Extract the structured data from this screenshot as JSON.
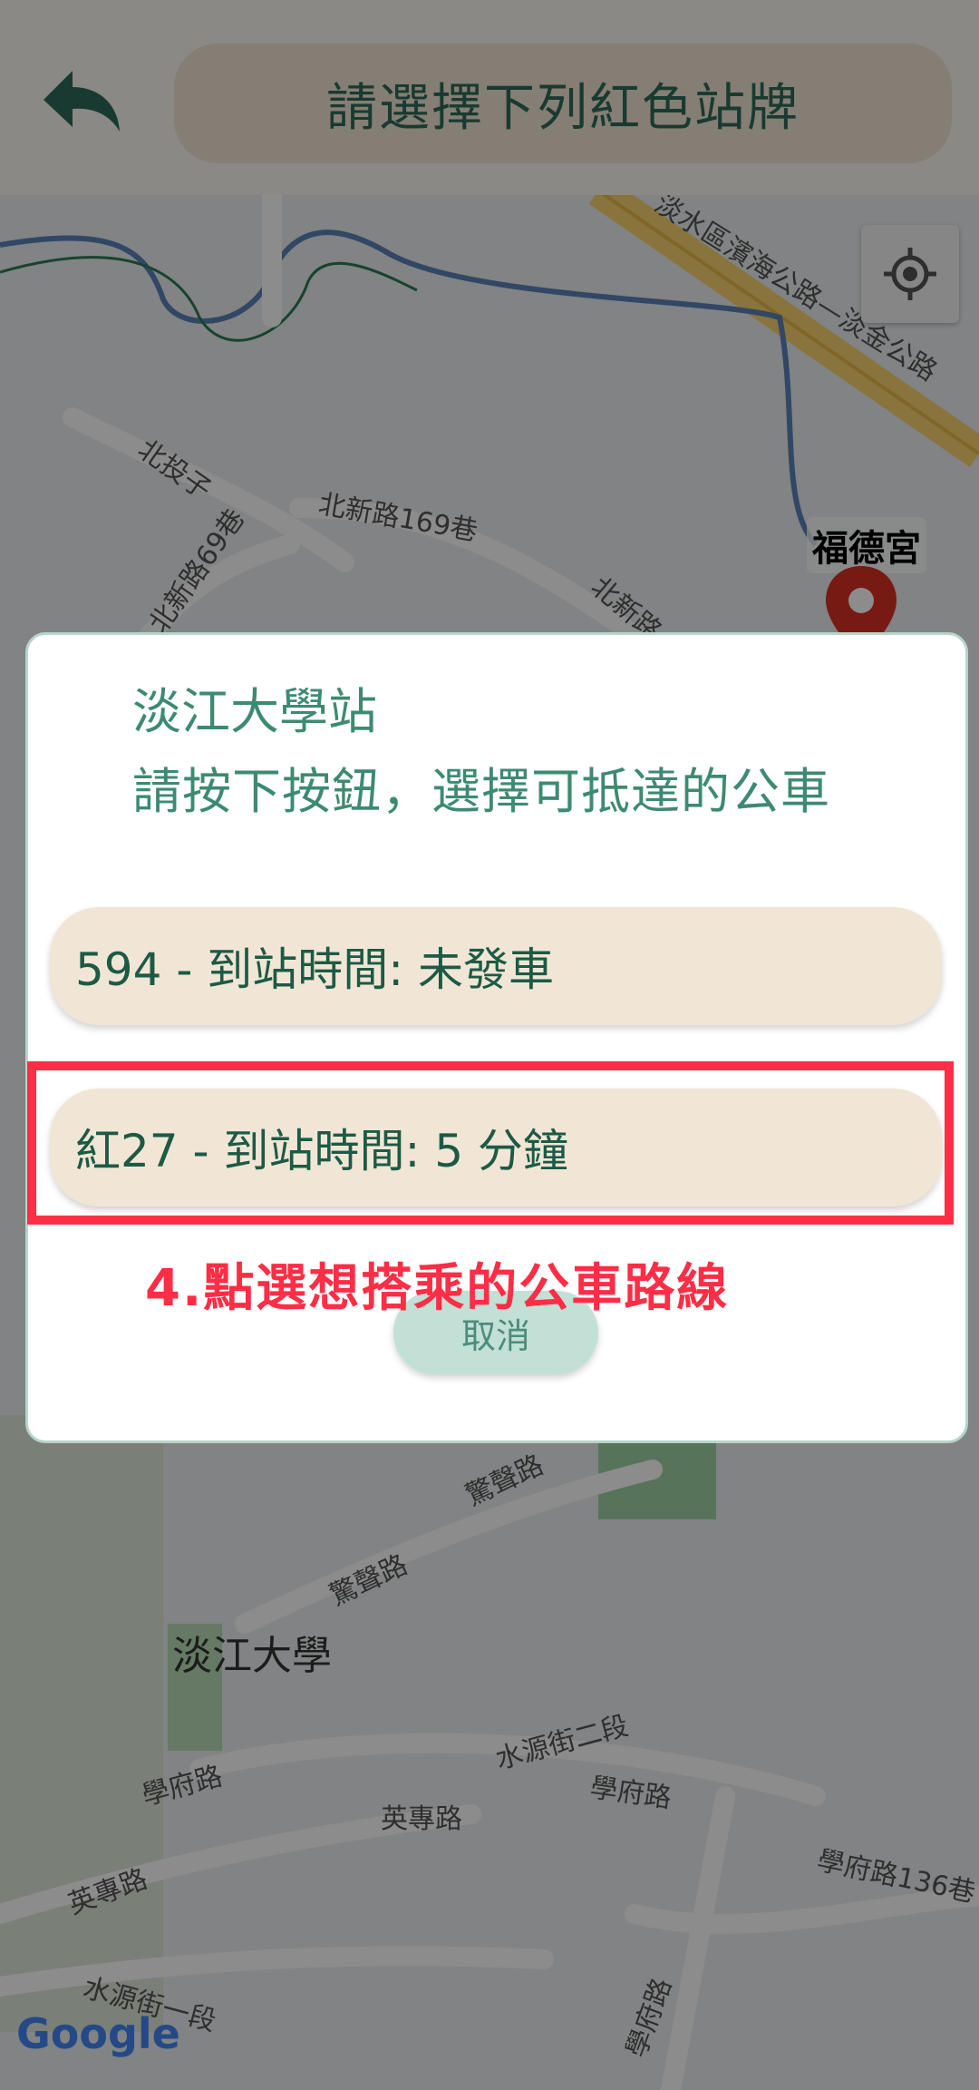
{
  "header": {
    "title": "請選擇下列紅色站牌"
  },
  "map": {
    "labels": [
      "淡水區濱海公路—淡金公路",
      "北投子",
      "北新路169巷",
      "北新路",
      "北新路69巷",
      "驚聲路",
      "驚聲路",
      "淡江大學",
      "水源街二段",
      "學府路",
      "學府路",
      "英專路",
      "英專路",
      "學府路136巷",
      "水源街一段",
      "學府路"
    ],
    "place_label": "福德宮",
    "attribution": "Google"
  },
  "dialog": {
    "title": "淡江大學站",
    "subtitle": "請按下按鈕，選擇可抵達的公車",
    "routes": [
      {
        "label": "594 - 到站時間: 未發車"
      },
      {
        "label": "紅27 - 到站時間: 5 分鐘"
      }
    ],
    "cancel_label": "取消"
  },
  "annotation": {
    "instruction": "4.點選想搭乘的公車路線",
    "color": "#ff2d45"
  }
}
